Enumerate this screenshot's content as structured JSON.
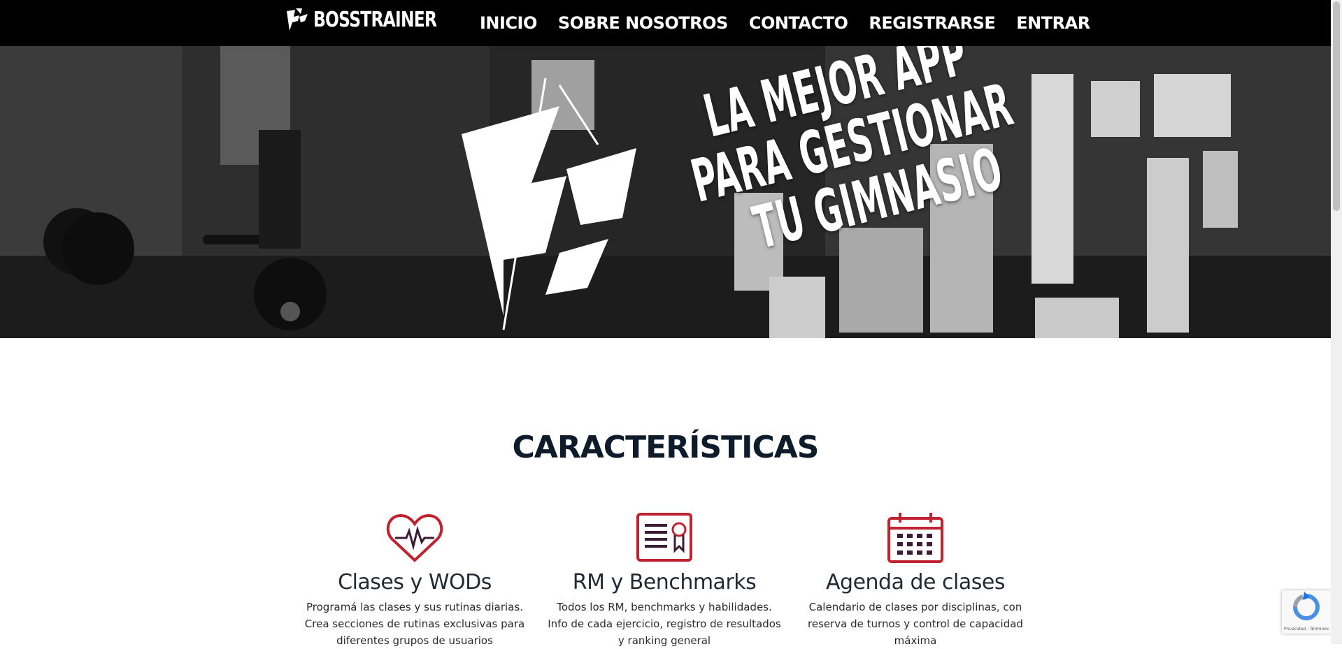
{
  "brand": {
    "name": "BOSSTRAINER"
  },
  "nav": {
    "items": [
      "INICIO",
      "SOBRE NOSOTROS",
      "CONTACTO",
      "REGISTRARSE",
      "ENTRAR"
    ]
  },
  "hero": {
    "lines": [
      "LA MEJOR APP",
      "PARA GESTIONAR",
      "TU GIMNASIO"
    ]
  },
  "features": {
    "title": "CARACTERÍSTICAS",
    "items": [
      {
        "icon": "heart-pulse-icon",
        "title": "Clases y WODs",
        "text": "Programá las clases y sus rutinas diarias. Crea secciones de rutinas exclusivas para diferentes grupos de usuarios"
      },
      {
        "icon": "certificate-icon",
        "title": "RM y Benchmarks",
        "text": "Todos los RM, benchmarks y habilidades. Info de cada ejercicio, registro de resultados y ranking general"
      },
      {
        "icon": "calendar-icon",
        "title": "Agenda de clases",
        "text": "Calendario de clases por disciplinas, con reserva de turnos y control de capacidad máxima"
      }
    ]
  },
  "recaptcha": {
    "footer": "Privacidad - Términos"
  },
  "colors": {
    "accent": "#c0222f",
    "accent_dark": "#2b1d3a",
    "nav_bg": "#000000",
    "title": "#0d1b2a"
  }
}
